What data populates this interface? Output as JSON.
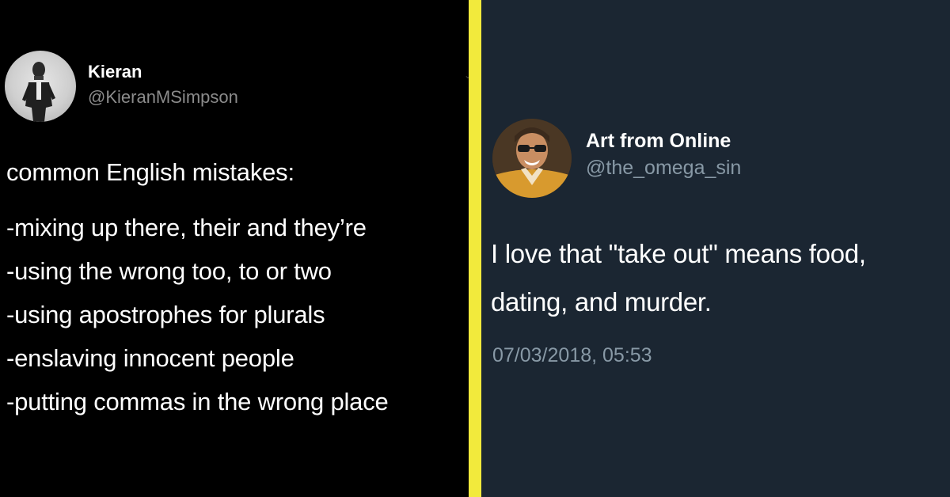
{
  "left_tweet": {
    "name": "Kieran",
    "handle": "@KieranMSimpson",
    "lines": [
      "common English mistakes:",
      "-mixing up there, their and they’re",
      "-using the wrong too, to or two",
      "-using apostrophes for plurals",
      "-enslaving innocent people",
      "-putting commas in the wrong place"
    ]
  },
  "right_tweet": {
    "name": "Art from Online",
    "handle": "@the_omega_sin",
    "lines": [
      "I love that \"take out\" means food,",
      "dating, and murder."
    ],
    "timestamp": "07/03/2018, 05:53"
  },
  "colors": {
    "divider": "#f2ea3c",
    "left_background": "#000000",
    "right_background": "#1b2632"
  }
}
